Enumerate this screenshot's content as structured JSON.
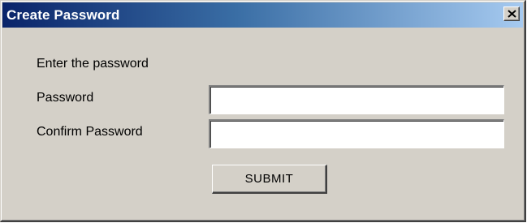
{
  "window": {
    "title": "Create Password",
    "close_icon": "close-icon"
  },
  "form": {
    "instruction": "Enter the password",
    "password_label": "Password",
    "password_value": "",
    "confirm_label": "Confirm Password",
    "confirm_value": "",
    "submit_label": "SUBMIT"
  },
  "colors": {
    "titlebar_start": "#0a246a",
    "titlebar_end": "#a6caf0",
    "dialog_background": "#d4d0c8"
  }
}
